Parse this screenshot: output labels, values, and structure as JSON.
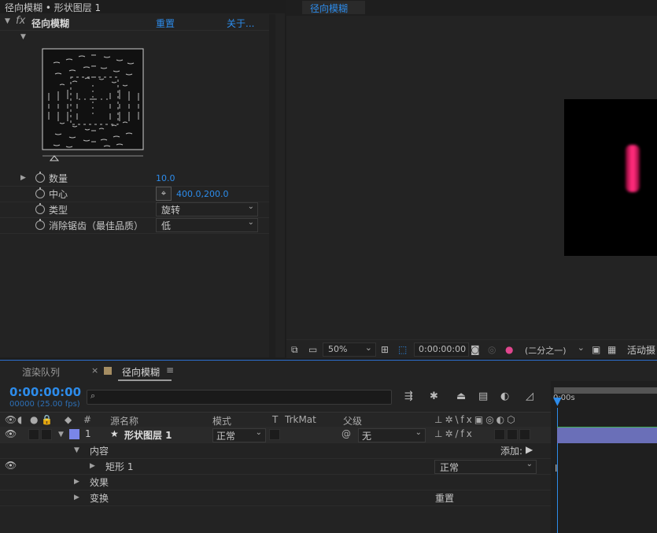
{
  "effect_controls": {
    "title": "径向模糊 • 形状图层 1",
    "fx_symbol": "fx",
    "effect_name": "径向模糊",
    "reset_label": "重置",
    "about_label": "关于...",
    "properties": [
      {
        "label": "数量",
        "value": "10.0"
      },
      {
        "label": "中心",
        "value": "400.0,200.0"
      },
      {
        "label": "类型",
        "value": "旋转"
      },
      {
        "label": "消除锯齿（最佳品质）",
        "value": "低"
      }
    ]
  },
  "viewer": {
    "tab_label": "径向模糊",
    "zoom": "50%",
    "timecode": "0:00:00:00",
    "resolution": "(二分之一)",
    "camera": "活动摄"
  },
  "timeline": {
    "tabs": [
      {
        "label": "渲染队列"
      },
      {
        "label": "径向模糊"
      }
    ],
    "current_time": "0:00:00:00",
    "fps": "00000 (25.00 fps)",
    "columns": {
      "number": "#",
      "source_name": "源名称",
      "mode": "模式",
      "t": "T",
      "trkmat": "TrkMat",
      "parent": "父级"
    },
    "layer": {
      "number": "1",
      "name": "形状图层 1",
      "mode": "正常",
      "parent": "无",
      "color": "#7a86e8"
    },
    "tree": {
      "contents": "内容",
      "add_label": "添加:",
      "rectangle": "矩形 1",
      "rectangle_mode": "正常",
      "effects": "效果",
      "transform": "变换",
      "transform_reset": "重置"
    },
    "ruler_time": "0:00s"
  }
}
